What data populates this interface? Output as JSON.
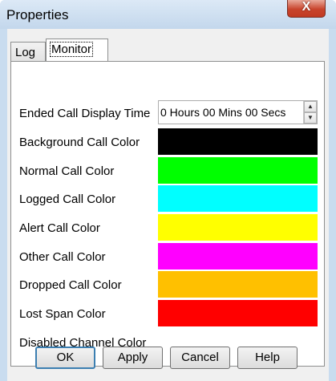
{
  "window": {
    "title": "Properties",
    "close_glyph": "X"
  },
  "tabs": [
    {
      "label": "Log",
      "active": false
    },
    {
      "label": "Monitor",
      "active": true
    }
  ],
  "monitor": {
    "ended_call": {
      "label": "Ended Call Display Time",
      "value": "0 Hours  00 Mins  00 Secs"
    },
    "colors": [
      {
        "label": "Background Call Color",
        "color": "#000000"
      },
      {
        "label": "Normal Call Color",
        "color": "#00ff00"
      },
      {
        "label": "Logged Call Color",
        "color": "#00ffff"
      },
      {
        "label": "Alert Call Color",
        "color": "#ffff00"
      },
      {
        "label": "Other Call Color",
        "color": "#ff00ff"
      },
      {
        "label": "Dropped Call Color",
        "color": "#ffc000"
      },
      {
        "label": "Lost Span Color",
        "color": "#ff0000"
      },
      {
        "label": "Disabled Channel Color",
        "color": "#ffffff"
      }
    ]
  },
  "buttons": {
    "ok": "OK",
    "apply": "Apply",
    "cancel": "Cancel",
    "help": "Help"
  },
  "icons": {
    "spin_up": "triangle-up",
    "spin_down": "triangle-down",
    "close": "x-mark"
  }
}
